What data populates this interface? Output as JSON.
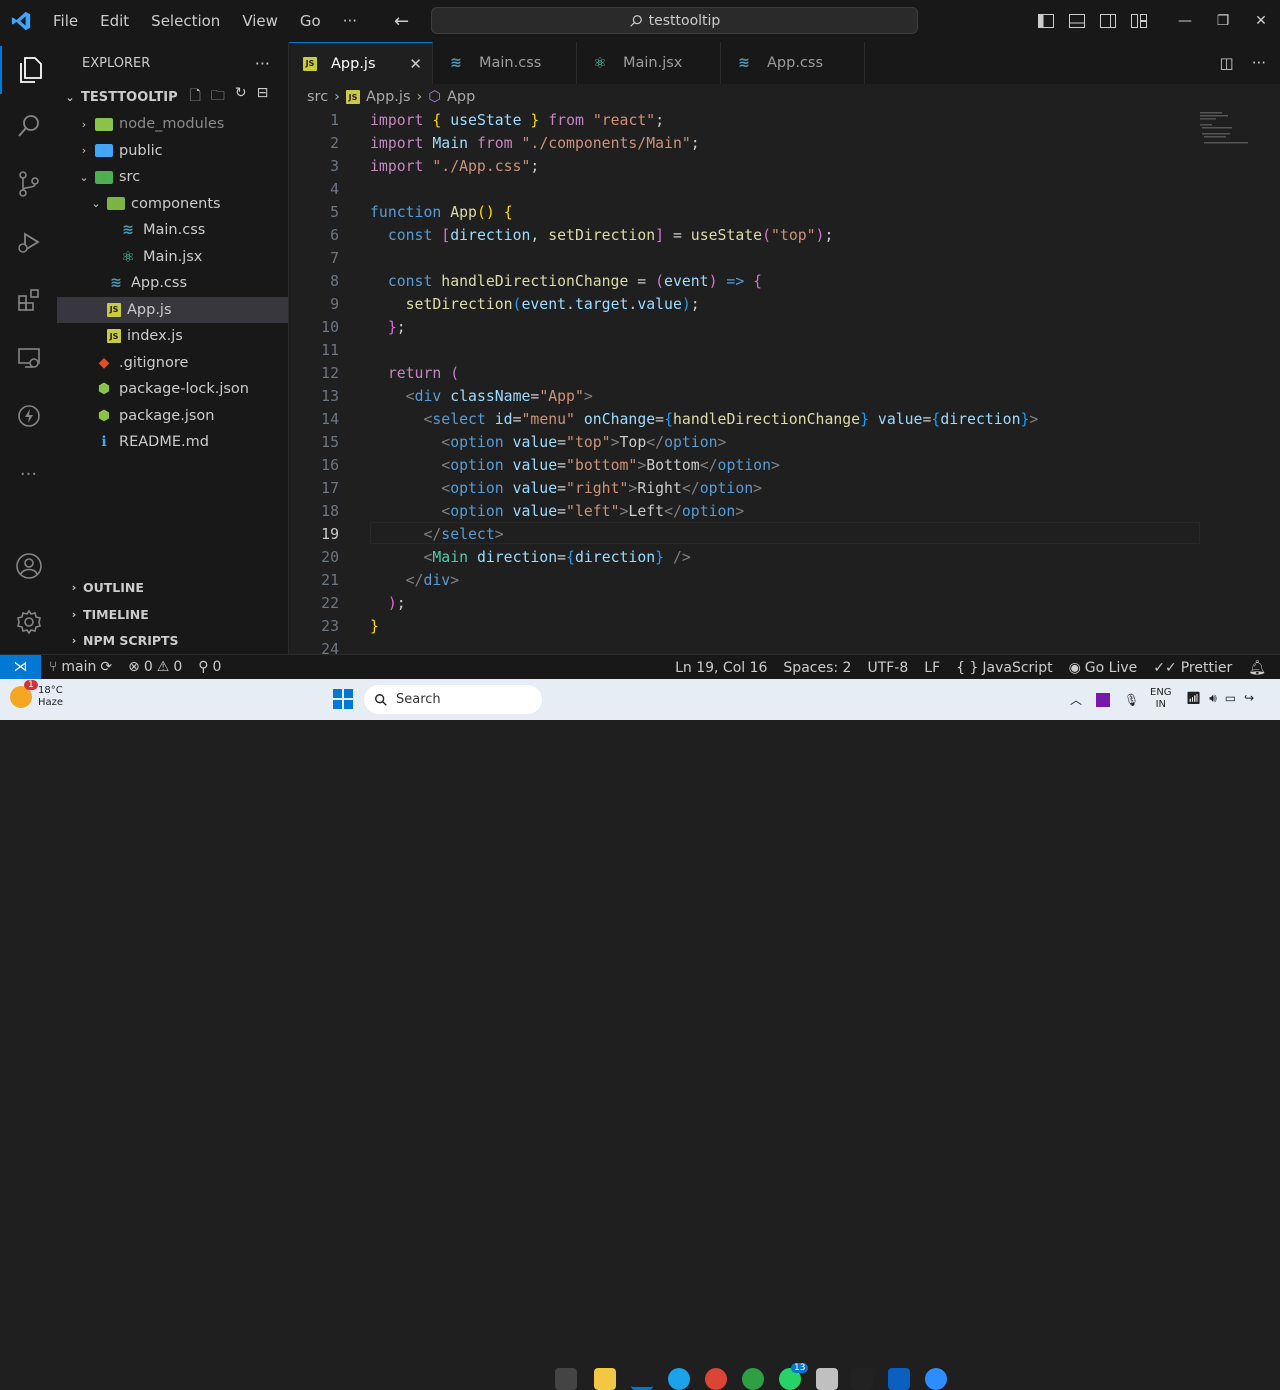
{
  "titlebar": {
    "menu": [
      "File",
      "Edit",
      "Selection",
      "View",
      "Go"
    ],
    "more": "···",
    "search": "testtooltip"
  },
  "sidebar": {
    "title": "EXPLORER",
    "more": "···",
    "project": "TESTTOOLTIP",
    "tree": [
      {
        "label": "node_modules",
        "depth": 0,
        "kind": "folder",
        "expanded": false
      },
      {
        "label": "public",
        "depth": 0,
        "kind": "folder",
        "expanded": false
      },
      {
        "label": "src",
        "depth": 0,
        "kind": "folder",
        "expanded": true
      },
      {
        "label": "components",
        "depth": 1,
        "kind": "folder",
        "expanded": true
      },
      {
        "label": "Main.css",
        "depth": 2,
        "kind": "css"
      },
      {
        "label": "Main.jsx",
        "depth": 2,
        "kind": "react"
      },
      {
        "label": "App.css",
        "depth": 1,
        "kind": "css"
      },
      {
        "label": "App.js",
        "depth": 1,
        "kind": "js",
        "selected": true
      },
      {
        "label": "index.js",
        "depth": 1,
        "kind": "js"
      },
      {
        "label": ".gitignore",
        "depth": 0,
        "kind": "git"
      },
      {
        "label": "package-lock.json",
        "depth": 0,
        "kind": "json"
      },
      {
        "label": "package.json",
        "depth": 0,
        "kind": "json"
      },
      {
        "label": "README.md",
        "depth": 0,
        "kind": "info"
      }
    ],
    "sections": [
      "OUTLINE",
      "TIMELINE",
      "NPM SCRIPTS"
    ]
  },
  "tabs": [
    {
      "label": "App.js",
      "kind": "js",
      "active": true
    },
    {
      "label": "Main.css",
      "kind": "css"
    },
    {
      "label": "Main.jsx",
      "kind": "react"
    },
    {
      "label": "App.css",
      "kind": "css"
    }
  ],
  "breadcrumb": [
    "src",
    "App.js",
    "App"
  ],
  "editor": {
    "current_line": 19,
    "line_numbers": [
      "1",
      "2",
      "3",
      "4",
      "5",
      "6",
      "7",
      "8",
      "9",
      "10",
      "11",
      "12",
      "13",
      "14",
      "15",
      "16",
      "17",
      "18",
      "19",
      "20",
      "21",
      "22",
      "23",
      "24"
    ]
  },
  "statusbar": {
    "branch": "main",
    "errors": "0",
    "warnings": "0",
    "ports": "0",
    "position": "Ln 19, Col 16",
    "spaces": "Spaces: 2",
    "encoding": "UTF-8",
    "eol": "LF",
    "language": "JavaScript",
    "golive": "Go Live",
    "prettier": "Prettier"
  },
  "taskbar": {
    "weather_temp": "18°C",
    "weather_desc": "Haze",
    "search": "Search",
    "lang1": "ENG",
    "lang2": "IN",
    "badge_weather": "1",
    "badge_whatsapp": "13"
  },
  "colors": {
    "accent": "#0078d4",
    "bg": "#1f1f1f",
    "panel": "#181818"
  }
}
